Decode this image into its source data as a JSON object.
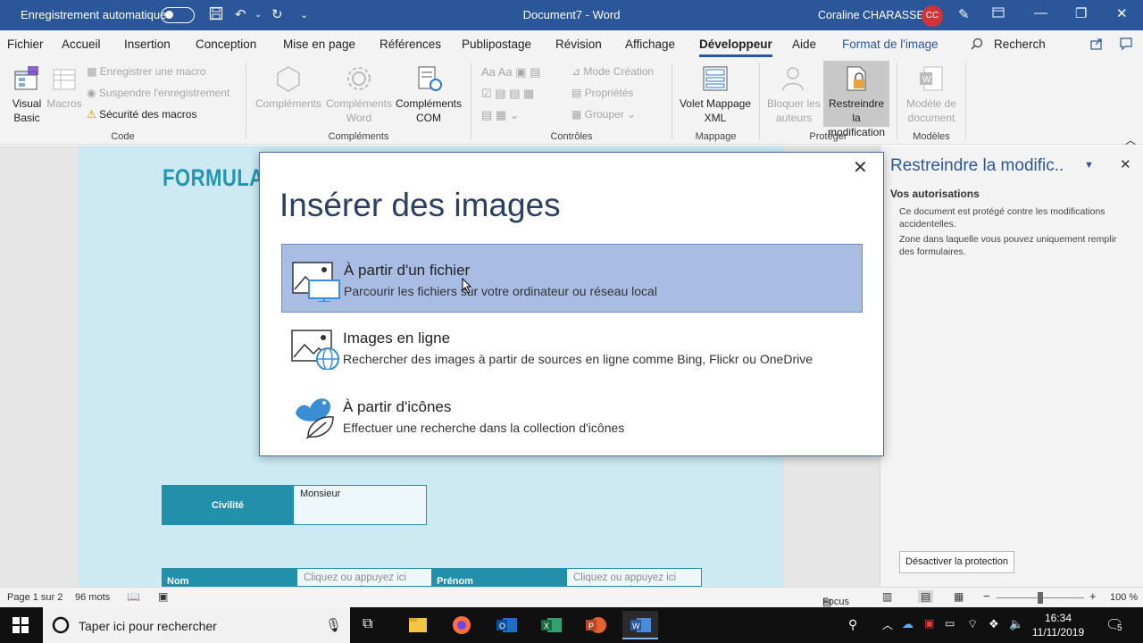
{
  "titlebar": {
    "autosave_label": "Enregistrement automatique",
    "document_title": "Document7  -  Word",
    "user_name": "Coraline CHARASSE",
    "user_initials": "CC"
  },
  "tabs": [
    {
      "label": "Fichier"
    },
    {
      "label": "Accueil"
    },
    {
      "label": "Insertion"
    },
    {
      "label": "Conception"
    },
    {
      "label": "Mise en page"
    },
    {
      "label": "Références"
    },
    {
      "label": "Publipostage"
    },
    {
      "label": "Révision"
    },
    {
      "label": "Affichage"
    },
    {
      "label": "Développeur"
    },
    {
      "label": "Aide"
    },
    {
      "label": "Format de l'image"
    }
  ],
  "tell_me": "Recherch",
  "ribbon": {
    "visual_basic": "Visual Basic",
    "macros": "Macros",
    "record_macro": "Enregistrer une macro",
    "pause_recording": "Suspendre l'enregistrement",
    "macro_security": "Sécurité des macros",
    "group_code": "Code",
    "addins": "Compléments",
    "word_addins": "Compléments Word",
    "com_addins": "Compléments COM",
    "group_addins": "Compléments",
    "design_mode": "Mode Création",
    "properties": "Propriétés",
    "group": "Grouper",
    "group_controls": "Contrôles",
    "xml_mapping": "Volet Mappage XML",
    "group_mapping": "Mappage",
    "block_authors": "Bloquer les auteurs",
    "restrict_editing": "Restreindre la modification",
    "group_protect": "Protéger",
    "document_template": "Modèle de document",
    "group_templates": "Modèles"
  },
  "document": {
    "form_title": "FORMULAI",
    "civility_label": "Civilité",
    "civility_value": "Monsieur",
    "name_label": "Nom",
    "firstname_label": "Prénom",
    "placeholder_1": "Cliquez ou appuyez ici pour entrer du texte.",
    "placeholder_2": "Cliquez ou appuyez ici pour entrer du texte."
  },
  "pane": {
    "title": "Restreindre la modific..",
    "subtitle": "Vos autorisations",
    "text1": "Ce document est protégé contre les modifications accidentelles.",
    "text2": "Zone dans laquelle vous pouvez uniquement remplir des formulaires.",
    "button": "Désactiver la protection"
  },
  "modal": {
    "title": "Insérer des images",
    "options": [
      {
        "title": "À partir d'un fichier",
        "description": "Parcourir les fichiers sur votre ordinateur ou réseau local",
        "selected": true
      },
      {
        "title": "Images en ligne",
        "description": "Rechercher des images à partir de sources en ligne comme Bing, Flickr ou OneDrive",
        "selected": false
      },
      {
        "title": "À partir d'icônes",
        "description": "Effectuer une recherche dans la collection d'icônes",
        "selected": false
      }
    ]
  },
  "status": {
    "page": "Page 1 sur 2",
    "words": "96 mots",
    "focus": "Focus",
    "zoom": "100 %"
  },
  "taskbar": {
    "search_placeholder": "Taper ici pour rechercher",
    "time": "16:34",
    "date": "11/11/2019",
    "notifications": "5"
  },
  "colors": {
    "word_blue": "#2b579a",
    "selection": "#a9bde4",
    "form_teal": "#228fab"
  }
}
